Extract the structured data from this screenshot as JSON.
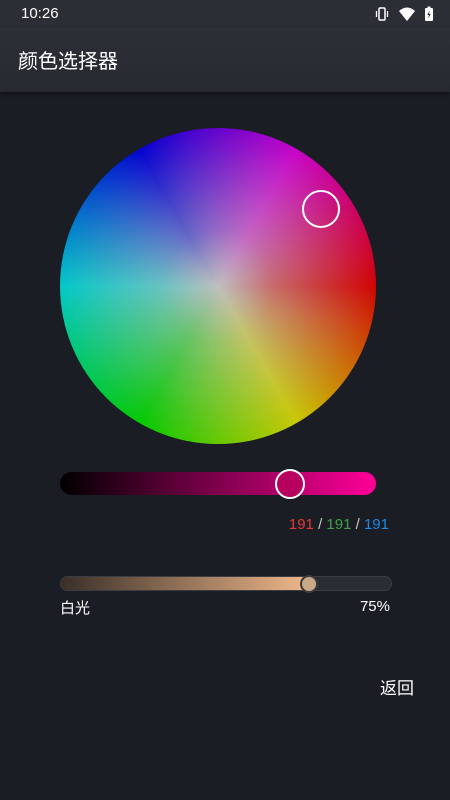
{
  "status_bar": {
    "time": "10:26",
    "icons": [
      "vibrate-icon",
      "wifi-icon",
      "battery-charging-icon"
    ]
  },
  "app_bar": {
    "title": "颜色选择器"
  },
  "color_wheel": {
    "selected_hue_color": "#d020c0"
  },
  "brightness": {
    "start_color": "#000000",
    "end_color": "#ff0099",
    "level_fraction": 0.73
  },
  "rgb": {
    "r": "191",
    "g": "191",
    "b": "191",
    "separator": "/"
  },
  "white_light": {
    "label": "白光",
    "percent_label": "75%",
    "level_fraction": 0.75
  },
  "actions": {
    "back_label": "返回"
  },
  "colors": {
    "background": "#1a1d24",
    "red": "#e53935",
    "green": "#43a047",
    "blue": "#1e88e5"
  }
}
